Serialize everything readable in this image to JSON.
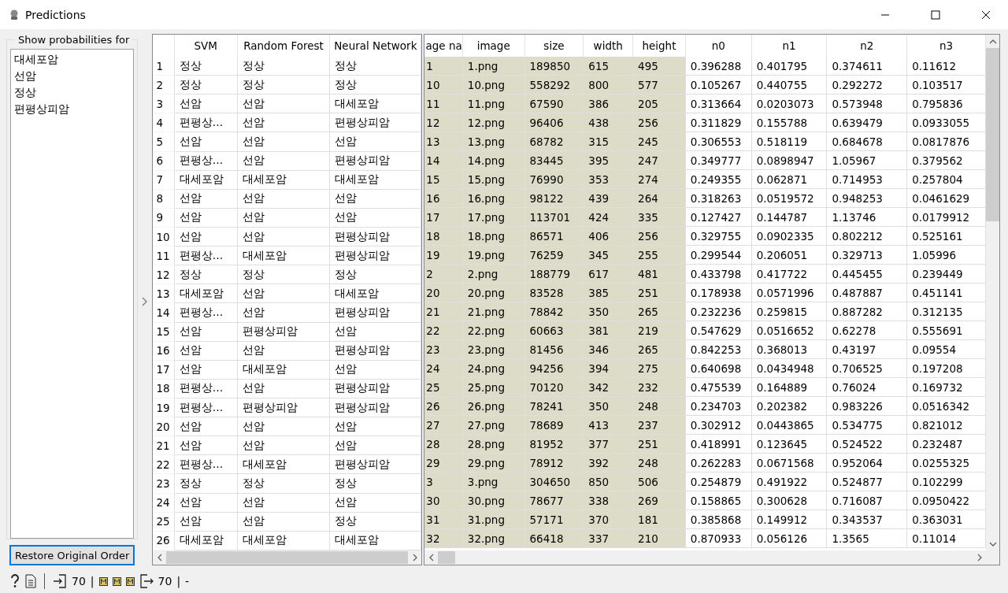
{
  "window": {
    "title": "Predictions"
  },
  "class_panel": {
    "title": "Show probabilities for",
    "items": [
      "대세포암",
      "선암",
      "정상",
      "편평상피암"
    ],
    "button": "Restore Original Order"
  },
  "predictions_table": {
    "columns": [
      "",
      "SVM",
      "Random Forest",
      "Neural Network"
    ],
    "rows": [
      [
        "1",
        "정상",
        "정상",
        "정상"
      ],
      [
        "2",
        "정상",
        "정상",
        "정상"
      ],
      [
        "3",
        "선암",
        "선암",
        "대세포암"
      ],
      [
        "4",
        "편평상…",
        "선암",
        "편평상피암"
      ],
      [
        "5",
        "선암",
        "선암",
        "선암"
      ],
      [
        "6",
        "편평상…",
        "선암",
        "편평상피암"
      ],
      [
        "7",
        "대세포암",
        "대세포암",
        "대세포암"
      ],
      [
        "8",
        "선암",
        "선암",
        "선암"
      ],
      [
        "9",
        "선암",
        "선암",
        "선암"
      ],
      [
        "10",
        "선암",
        "선암",
        "편평상피암"
      ],
      [
        "11",
        "편평상…",
        "대세포암",
        "편평상피암"
      ],
      [
        "12",
        "정상",
        "정상",
        "정상"
      ],
      [
        "13",
        "대세포암",
        "선암",
        "대세포암"
      ],
      [
        "14",
        "편평상…",
        "선암",
        "편평상피암"
      ],
      [
        "15",
        "선암",
        "편평상피암",
        "선암"
      ],
      [
        "16",
        "선암",
        "선암",
        "편평상피암"
      ],
      [
        "17",
        "선암",
        "대세포암",
        "선암"
      ],
      [
        "18",
        "편평상…",
        "선암",
        "편평상피암"
      ],
      [
        "19",
        "편평상…",
        "편평상피암",
        "편평상피암"
      ],
      [
        "20",
        "선암",
        "선암",
        "선암"
      ],
      [
        "21",
        "선암",
        "선암",
        "선암"
      ],
      [
        "22",
        "편평상…",
        "대세포암",
        "편평상피암"
      ],
      [
        "23",
        "정상",
        "정상",
        "정상"
      ],
      [
        "24",
        "선암",
        "선암",
        "선암"
      ],
      [
        "25",
        "선암",
        "선암",
        "정상"
      ],
      [
        "26",
        "대세포암",
        "대세포암",
        "대세포암"
      ]
    ]
  },
  "data_table": {
    "columns": [
      {
        "label": "age na",
        "kind": "meta"
      },
      {
        "label": "image",
        "kind": "meta"
      },
      {
        "label": "size",
        "kind": "meta"
      },
      {
        "label": "width",
        "kind": "meta"
      },
      {
        "label": "height",
        "kind": "meta"
      },
      {
        "label": "n0",
        "kind": "feature"
      },
      {
        "label": "n1",
        "kind": "feature"
      },
      {
        "label": "n2",
        "kind": "feature"
      },
      {
        "label": "n3",
        "kind": "feature"
      }
    ],
    "rows": [
      [
        "1",
        "1.png",
        "189850",
        "615",
        "495",
        "0.396288",
        "0.401795",
        "0.374611",
        "0.11612"
      ],
      [
        "10",
        "10.png",
        "558292",
        "800",
        "577",
        "0.105267",
        "0.440755",
        "0.292272",
        "0.103517"
      ],
      [
        "11",
        "11.png",
        "67590",
        "386",
        "205",
        "0.313664",
        "0.0203073",
        "0.573948",
        "0.795836"
      ],
      [
        "12",
        "12.png",
        "96406",
        "438",
        "256",
        "0.311829",
        "0.155788",
        "0.639479",
        "0.0933055"
      ],
      [
        "13",
        "13.png",
        "68782",
        "315",
        "245",
        "0.306553",
        "0.518119",
        "0.684678",
        "0.0817876"
      ],
      [
        "14",
        "14.png",
        "83445",
        "395",
        "247",
        "0.349777",
        "0.0898947",
        "1.05967",
        "0.379562"
      ],
      [
        "15",
        "15.png",
        "76990",
        "353",
        "274",
        "0.249355",
        "0.062871",
        "0.714953",
        "0.257804"
      ],
      [
        "16",
        "16.png",
        "98122",
        "439",
        "264",
        "0.318263",
        "0.0519572",
        "0.948253",
        "0.0461629"
      ],
      [
        "17",
        "17.png",
        "113701",
        "424",
        "335",
        "0.127427",
        "0.144787",
        "1.13746",
        "0.0179912"
      ],
      [
        "18",
        "18.png",
        "86571",
        "406",
        "256",
        "0.329755",
        "0.0902335",
        "0.802212",
        "0.525161"
      ],
      [
        "19",
        "19.png",
        "76259",
        "345",
        "255",
        "0.299544",
        "0.206051",
        "0.329713",
        "1.05996"
      ],
      [
        "2",
        "2.png",
        "188779",
        "617",
        "481",
        "0.433798",
        "0.417722",
        "0.445455",
        "0.239449"
      ],
      [
        "20",
        "20.png",
        "83528",
        "385",
        "251",
        "0.178938",
        "0.0571996",
        "0.487887",
        "0.451141"
      ],
      [
        "21",
        "21.png",
        "78842",
        "350",
        "265",
        "0.232236",
        "0.259815",
        "0.887282",
        "0.312135"
      ],
      [
        "22",
        "22.png",
        "60663",
        "381",
        "219",
        "0.547629",
        "0.0516652",
        "0.62278",
        "0.555691"
      ],
      [
        "23",
        "23.png",
        "81456",
        "346",
        "265",
        "0.842253",
        "0.368013",
        "0.43197",
        "0.09554"
      ],
      [
        "24",
        "24.png",
        "94256",
        "394",
        "275",
        "0.640698",
        "0.0434948",
        "0.706525",
        "0.197208"
      ],
      [
        "25",
        "25.png",
        "70120",
        "342",
        "232",
        "0.475539",
        "0.164889",
        "0.76024",
        "0.169732"
      ],
      [
        "26",
        "26.png",
        "78241",
        "350",
        "248",
        "0.234703",
        "0.202382",
        "0.983226",
        "0.0516342"
      ],
      [
        "27",
        "27.png",
        "78689",
        "413",
        "237",
        "0.302912",
        "0.0443865",
        "0.534775",
        "0.821012"
      ],
      [
        "28",
        "28.png",
        "81952",
        "377",
        "251",
        "0.418991",
        "0.123645",
        "0.524522",
        "0.232487"
      ],
      [
        "29",
        "29.png",
        "78912",
        "392",
        "248",
        "0.262283",
        "0.0671568",
        "0.952064",
        "0.0255325"
      ],
      [
        "3",
        "3.png",
        "304650",
        "850",
        "506",
        "0.254879",
        "0.491922",
        "0.524877",
        "0.102299"
      ],
      [
        "30",
        "30.png",
        "78677",
        "338",
        "269",
        "0.158865",
        "0.300628",
        "0.716087",
        "0.0950422"
      ],
      [
        "31",
        "31.png",
        "57171",
        "370",
        "181",
        "0.385868",
        "0.149912",
        "0.343537",
        "0.363031"
      ],
      [
        "32",
        "32.png",
        "66418",
        "337",
        "210",
        "0.870933",
        "0.056126",
        "1.3565",
        "0.11014"
      ]
    ]
  },
  "status_bar": {
    "input_count": "70",
    "separator_1": "|",
    "output_count": "70",
    "separator_2": "|",
    "message": "-"
  }
}
